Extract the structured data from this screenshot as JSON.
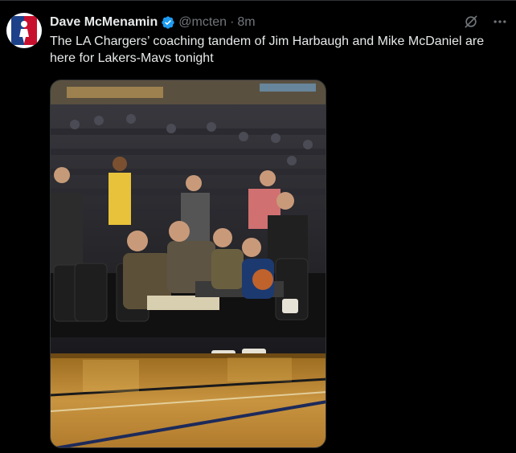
{
  "author": {
    "name": "Dave McMenamin",
    "handle": "@mcten",
    "separator": "·",
    "time": "8m",
    "verified": true,
    "avatar_icon": "nba-logo-avatar"
  },
  "tweet": {
    "text": "The LA Chargers’ coaching tandem of Jim Harbaugh and Mike McDaniel are here for Lakers-Mavs tonight"
  },
  "actions": {
    "grok_icon": "grok-icon",
    "more_icon": "more-icon"
  },
  "media": {
    "type": "photo",
    "subject": "courtside-photo"
  },
  "colors": {
    "background": "#000000",
    "text_primary": "#e7e9ea",
    "text_secondary": "#71767b",
    "verified_blue": "#1d9bf0",
    "border": "#2f3336"
  }
}
